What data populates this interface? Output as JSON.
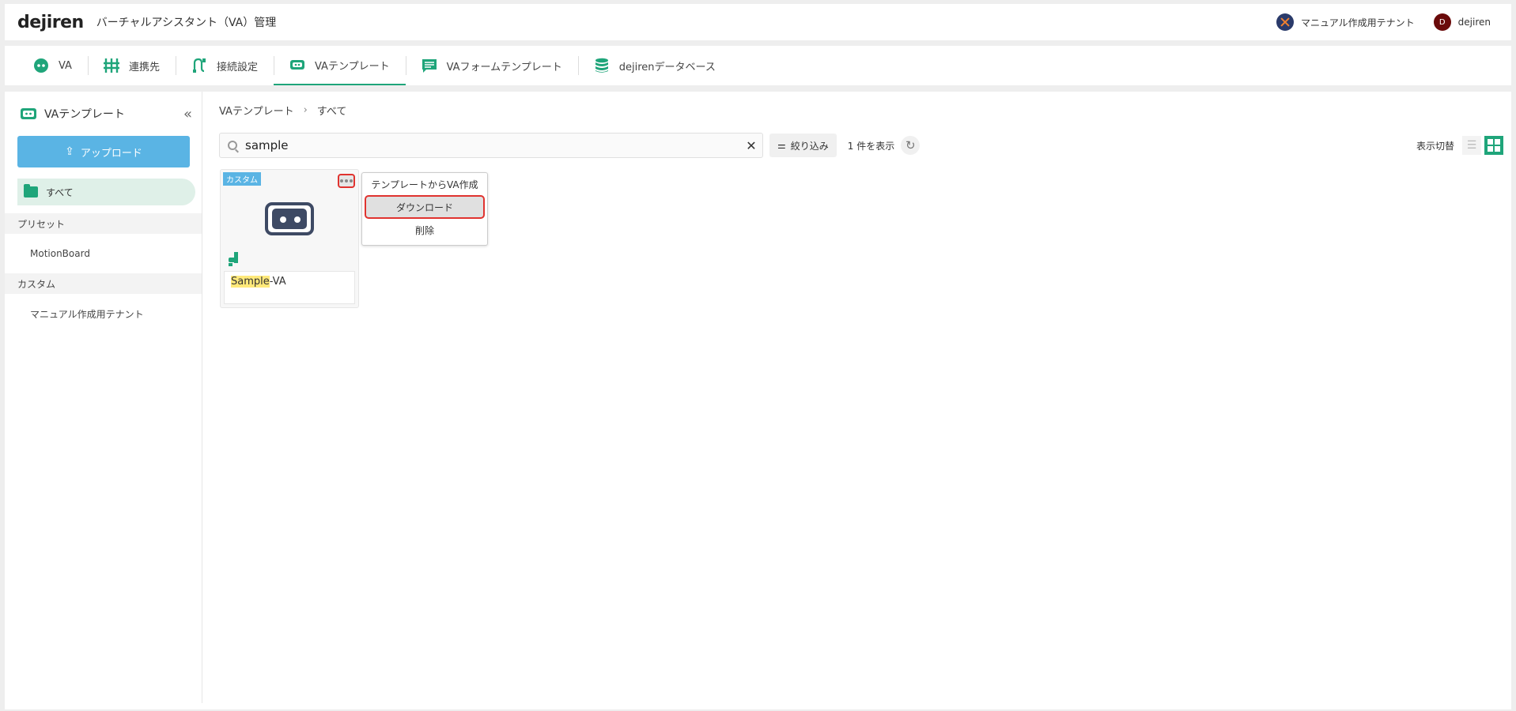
{
  "header": {
    "logo": "dejiren",
    "title": "バーチャルアシスタント（VA）管理",
    "tenant": "マニュアル作成用テナント",
    "user_initial": "D",
    "user_name": "dejiren"
  },
  "tabs": [
    {
      "label": "VA",
      "icon": "robot-face-icon"
    },
    {
      "label": "連携先",
      "icon": "connector-icon"
    },
    {
      "label": "接続設定",
      "icon": "plug-icon"
    },
    {
      "label": "VAテンプレート",
      "icon": "template-icon",
      "active": true
    },
    {
      "label": "VAフォームテンプレート",
      "icon": "form-icon"
    },
    {
      "label": "dejirenデータベース",
      "icon": "database-icon"
    }
  ],
  "sidebar": {
    "title": "VAテンプレート",
    "upload_label": "アップロード",
    "all_label": "すべて",
    "sections": [
      {
        "label": "プリセット",
        "items": [
          "MotionBoard"
        ]
      },
      {
        "label": "カスタム",
        "items": [
          "マニュアル作成用テナント"
        ]
      }
    ]
  },
  "breadcrumb": {
    "root": "VAテンプレート",
    "current": "すべて"
  },
  "toolbar": {
    "search_value": "sample",
    "filter_label": "絞り込み",
    "count_text": "1 件を表示",
    "view_switch_label": "表示切替"
  },
  "card": {
    "badge": "カスタム",
    "name_highlight": "Sample",
    "name_rest": "-VA"
  },
  "context_menu": {
    "items": [
      "テンプレートからVA作成",
      "ダウンロード",
      "削除"
    ],
    "selected_index": 1
  },
  "colors": {
    "accent": "#1fa57a",
    "upload": "#5ab4e4",
    "highlight": "#e0332f"
  }
}
